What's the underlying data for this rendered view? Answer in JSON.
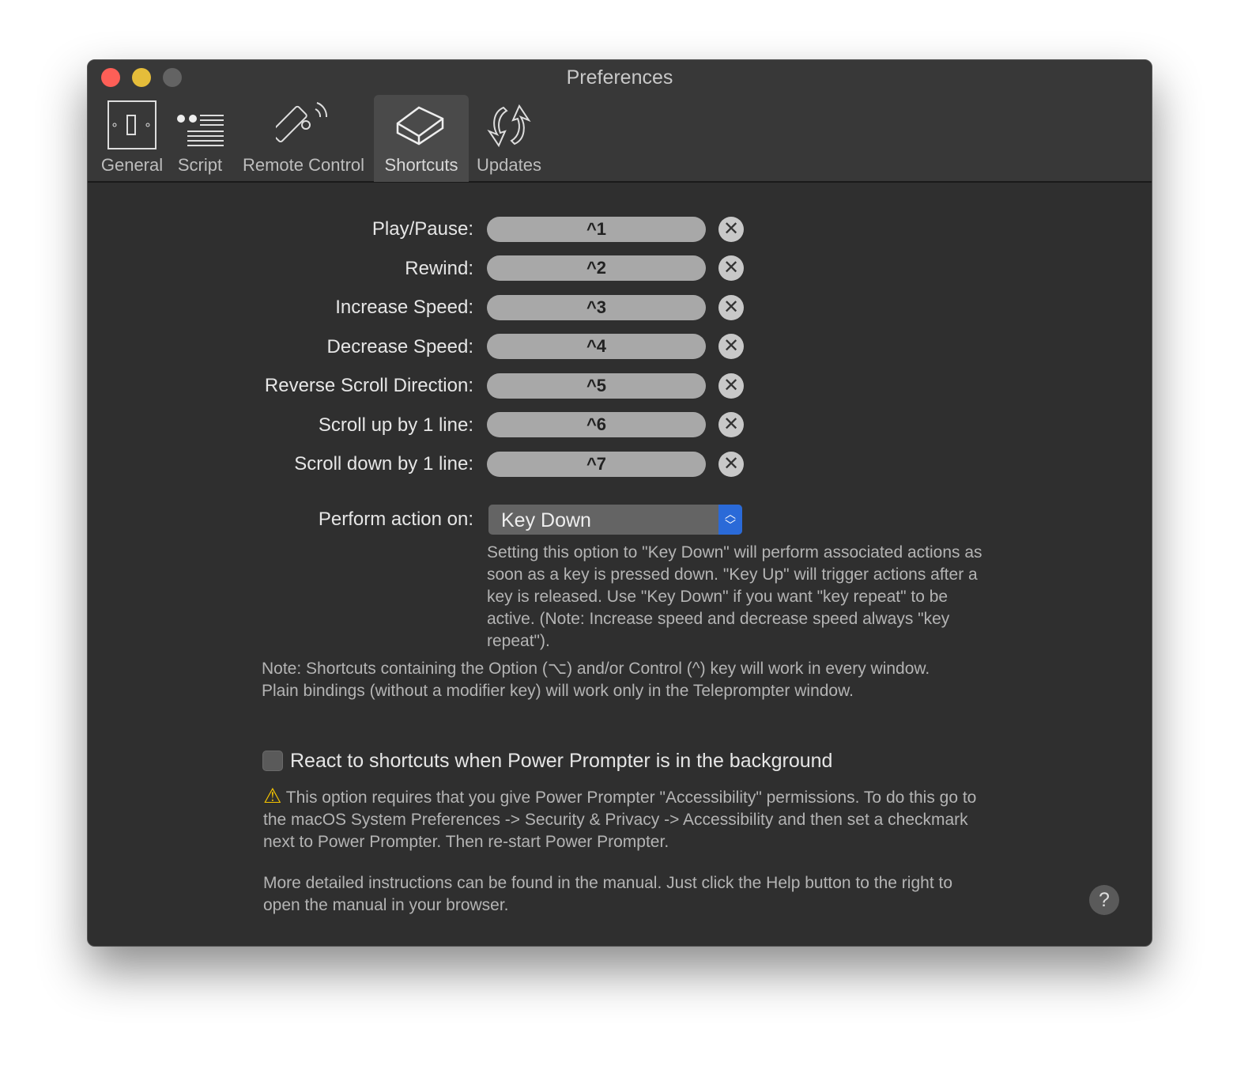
{
  "window": {
    "title": "Preferences",
    "traffic_light_colors": [
      "#fe5f57",
      "#e5bd3a",
      "#636363"
    ]
  },
  "tabs": [
    {
      "label": "General",
      "icon": "light-switch-icon"
    },
    {
      "label": "Script",
      "icon": "quote-text-icon"
    },
    {
      "label": "Remote Control",
      "icon": "remote-control-icon"
    },
    {
      "label": "Shortcuts",
      "icon": "keycap-icon",
      "active": true
    },
    {
      "label": "Updates",
      "icon": "update-arrows-icon"
    }
  ],
  "shortcuts": [
    {
      "label": "Play/Pause:",
      "value": "^1"
    },
    {
      "label": "Rewind:",
      "value": "^2"
    },
    {
      "label": "Increase Speed:",
      "value": "^3"
    },
    {
      "label": "Decrease Speed:",
      "value": "^4"
    },
    {
      "label": "Reverse Scroll Direction:",
      "value": "^5"
    },
    {
      "label": "Scroll up by 1 line:",
      "value": "^6"
    },
    {
      "label": "Scroll down by 1 line:",
      "value": "^7"
    }
  ],
  "perform": {
    "label": "Perform action on:",
    "value": "Key Down",
    "description": "Setting this option to \"Key Down\" will perform associated actions as soon as a key is pressed down. \"Key Up\" will trigger actions after a key is released. Use \"Key Down\" if you want \"key repeat\" to be active. (Note: Increase speed and decrease speed always \"key repeat\")."
  },
  "note": "Note: Shortcuts containing the Option (⌥) and/or Control (^) key will work in every window. Plain bindings (without a modifier key) will work only in the Teleprompter window.",
  "background": {
    "label": "React to shortcuts when Power Prompter is in the background",
    "checked": false,
    "warning": "This option requires that you give Power Prompter \"Accessibility\" permissions. To do this go to the macOS System Preferences -> Security & Privacy -> Accessibility and then set a checkmark next to Power Prompter. Then re-start Power Prompter.",
    "more": "More detailed instructions can be found in the manual. Just click the Help button to the right to open the manual in your browser."
  },
  "help_label": "?"
}
